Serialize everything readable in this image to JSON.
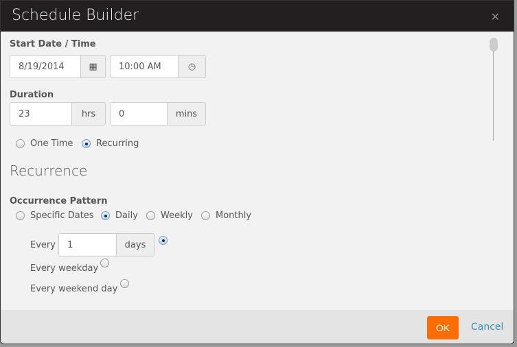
{
  "dialog": {
    "title": "Schedule Builder",
    "close_icon": "close-icon"
  },
  "start": {
    "label": "Start Date / Time",
    "date": "8/19/2014",
    "date_icon": "calendar-icon",
    "time": "10:00 AM",
    "time_icon": "clock-icon"
  },
  "duration": {
    "label": "Duration",
    "hours": "23",
    "hours_unit": "hrs",
    "minutes": "0",
    "minutes_unit": "mins"
  },
  "type": {
    "options": [
      "One Time",
      "Recurring"
    ],
    "selected": "Recurring"
  },
  "recurrence": {
    "heading": "Recurrence",
    "pattern_label": "Occurrence Pattern",
    "patterns": [
      "Specific Dates",
      "Daily",
      "Weekly",
      "Monthly"
    ],
    "selected": "Daily",
    "every_label": "Every",
    "every_value": "1",
    "every_unit": "days",
    "weekday_label": "Every weekday",
    "weekend_label": "Every weekend day",
    "daily_selected": "every"
  },
  "footer": {
    "ok": "OK",
    "cancel": "Cancel"
  },
  "colors": {
    "accent": "#ff6d00",
    "link": "#3a8fc0",
    "header": "#231f20"
  }
}
